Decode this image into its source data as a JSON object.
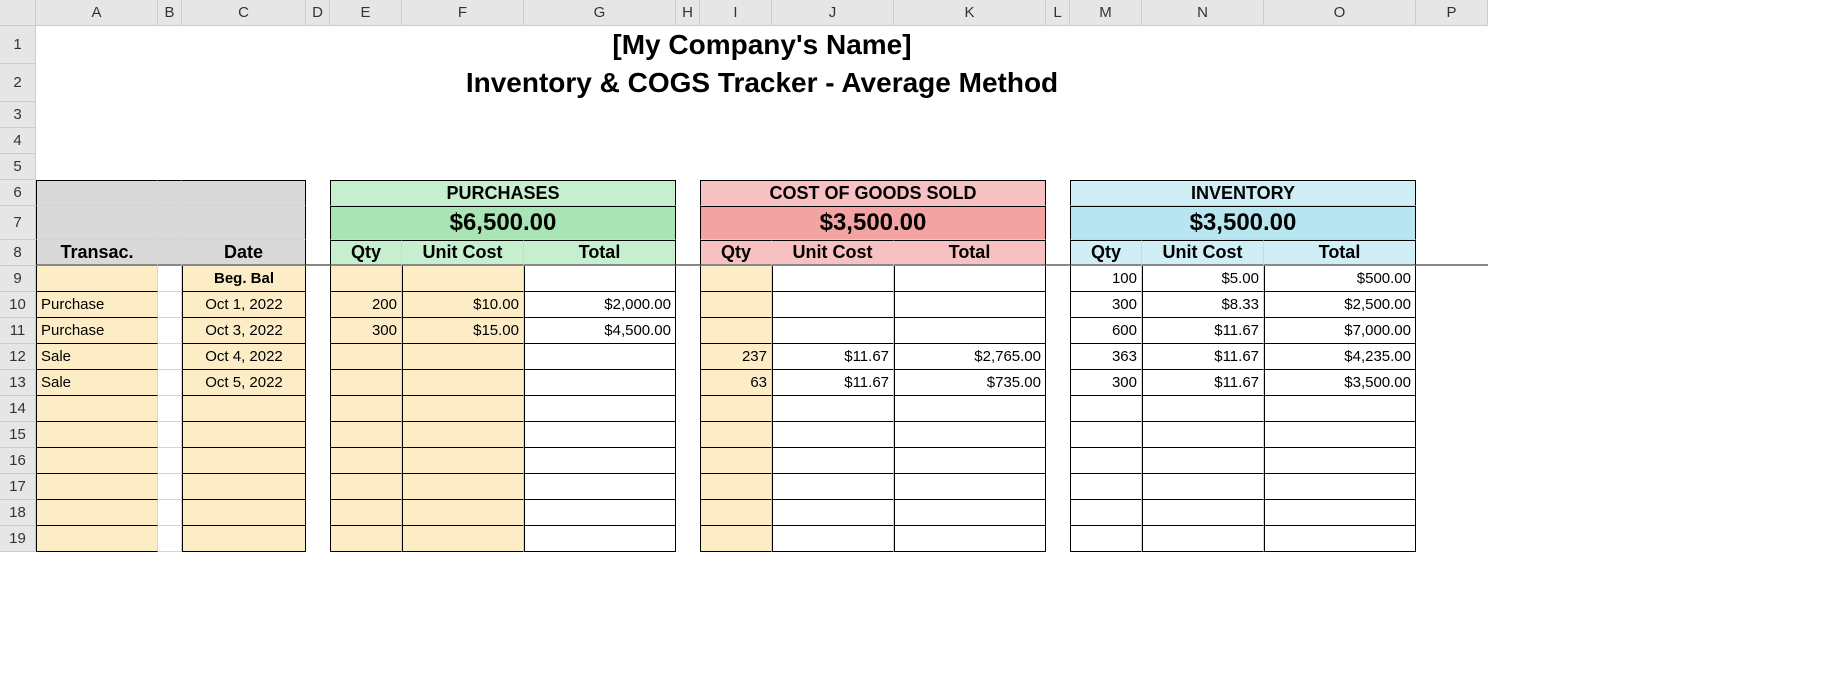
{
  "chart_data": {
    "type": "table",
    "title_lines": [
      "[My Company's Name]",
      "Inventory & COGS Tracker - Average Method"
    ],
    "sections": {
      "purchases": {
        "label": "PURCHASES",
        "total": "$6,500.00",
        "columns": [
          "Qty",
          "Unit Cost",
          "Total"
        ]
      },
      "cogs": {
        "label": "COST OF GOODS SOLD",
        "total": "$3,500.00",
        "columns": [
          "Qty",
          "Unit Cost",
          "Total"
        ]
      },
      "inventory": {
        "label": "INVENTORY",
        "total": "$3,500.00",
        "columns": [
          "Qty",
          "Unit Cost",
          "Total"
        ]
      }
    },
    "row_labels": {
      "transac": "Transac.",
      "date": "Date",
      "beg_bal": "Beg. Bal"
    },
    "rows": [
      {
        "transac": "",
        "date": "Beg. Bal",
        "p_qty": "",
        "p_uc": "",
        "p_tot": "",
        "c_qty": "",
        "c_uc": "",
        "c_tot": "",
        "i_qty": "100",
        "i_uc": "$5.00",
        "i_tot": "$500.00"
      },
      {
        "transac": "Purchase",
        "date": "Oct 1, 2022",
        "p_qty": "200",
        "p_uc": "$10.00",
        "p_tot": "$2,000.00",
        "c_qty": "",
        "c_uc": "",
        "c_tot": "",
        "i_qty": "300",
        "i_uc": "$8.33",
        "i_tot": "$2,500.00"
      },
      {
        "transac": "Purchase",
        "date": "Oct 3, 2022",
        "p_qty": "300",
        "p_uc": "$15.00",
        "p_tot": "$4,500.00",
        "c_qty": "",
        "c_uc": "",
        "c_tot": "",
        "i_qty": "600",
        "i_uc": "$11.67",
        "i_tot": "$7,000.00"
      },
      {
        "transac": "Sale",
        "date": "Oct 4, 2022",
        "p_qty": "",
        "p_uc": "",
        "p_tot": "",
        "c_qty": "237",
        "c_uc": "$11.67",
        "c_tot": "$2,765.00",
        "i_qty": "363",
        "i_uc": "$11.67",
        "i_tot": "$4,235.00"
      },
      {
        "transac": "Sale",
        "date": "Oct 5, 2022",
        "p_qty": "",
        "p_uc": "",
        "p_tot": "",
        "c_qty": "63",
        "c_uc": "$11.67",
        "c_tot": "$735.00",
        "i_qty": "300",
        "i_uc": "$11.67",
        "i_tot": "$3,500.00"
      }
    ]
  },
  "columns": [
    "A",
    "B",
    "C",
    "D",
    "E",
    "F",
    "G",
    "H",
    "I",
    "J",
    "K",
    "L",
    "M",
    "N",
    "O",
    "P"
  ],
  "row_numbers": [
    "1",
    "2",
    "3",
    "4",
    "5",
    "6",
    "7",
    "8",
    "9",
    "10",
    "11",
    "12",
    "13",
    "14",
    "15",
    "16",
    "17",
    "18",
    "19"
  ]
}
